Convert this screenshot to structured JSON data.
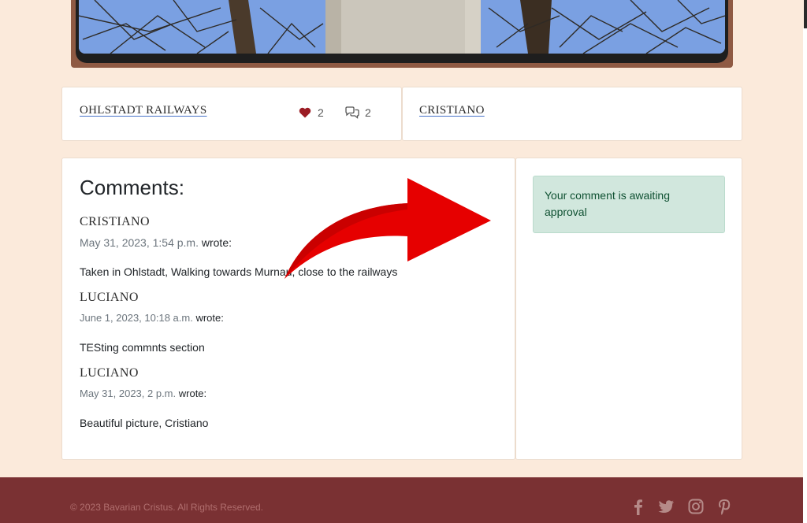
{
  "post": {
    "place": "OHLSTADT RAILWAYS",
    "likes": "2",
    "comment_count": "2",
    "author": "CRISTIANO"
  },
  "comments": {
    "title": "Comments:",
    "wrote": "wrote:",
    "items": [
      {
        "name": "CRISTIANO",
        "date": "May 31, 2023, 1:54 p.m.",
        "body": "Taken in Ohlstadt, Walking towards Murnau, close to the railways"
      },
      {
        "name": "LUCIANO",
        "date": "June 1, 2023, 10:18 a.m.",
        "body": "TESting commnts section"
      },
      {
        "name": "LUCIANO",
        "date": "May 31, 2023, 2 p.m.",
        "body": "Beautiful picture, Cristiano"
      }
    ]
  },
  "alert": {
    "message": "Your comment is awaiting approval"
  },
  "footer": {
    "copyright": "© 2023 Bavarian Cristus. All Rights Reserved.",
    "icons": [
      "facebook-icon",
      "twitter-icon",
      "instagram-icon",
      "pinterest-icon"
    ]
  },
  "colors": {
    "background": "#fbeadb",
    "footer": "#7a3133",
    "alert_bg": "#d1e7dd",
    "alert_text": "#0f5132",
    "heart": "#9b1c24",
    "arrow": "#e00000"
  }
}
